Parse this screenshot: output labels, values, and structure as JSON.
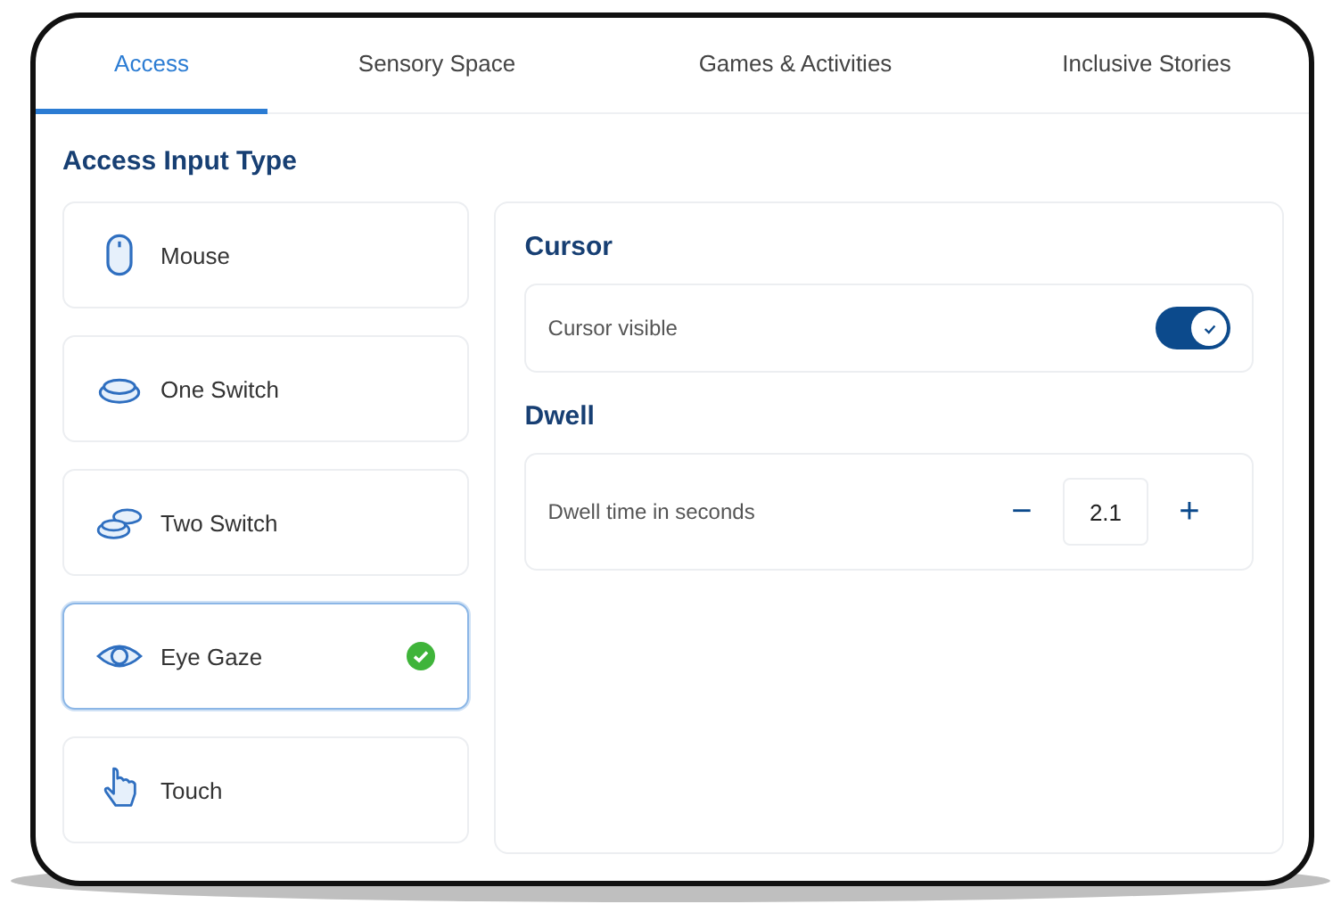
{
  "tabs": [
    {
      "label": "Access",
      "selected": true
    },
    {
      "label": "Sensory Space",
      "selected": false
    },
    {
      "label": "Games & Activities",
      "selected": false
    },
    {
      "label": "Inclusive Stories",
      "selected": false
    }
  ],
  "input_type": {
    "heading": "Access Input Type",
    "options": [
      {
        "label": "Mouse",
        "selected": false
      },
      {
        "label": "One Switch",
        "selected": false
      },
      {
        "label": "Two Switch",
        "selected": false
      },
      {
        "label": "Eye Gaze",
        "selected": true
      },
      {
        "label": "Touch",
        "selected": false
      }
    ]
  },
  "cursor": {
    "heading": "Cursor",
    "label": "Cursor visible",
    "on": true
  },
  "dwell": {
    "heading": "Dwell",
    "label": "Dwell time in seconds",
    "decrement": "−",
    "value": "2.1",
    "increment": "+"
  }
}
